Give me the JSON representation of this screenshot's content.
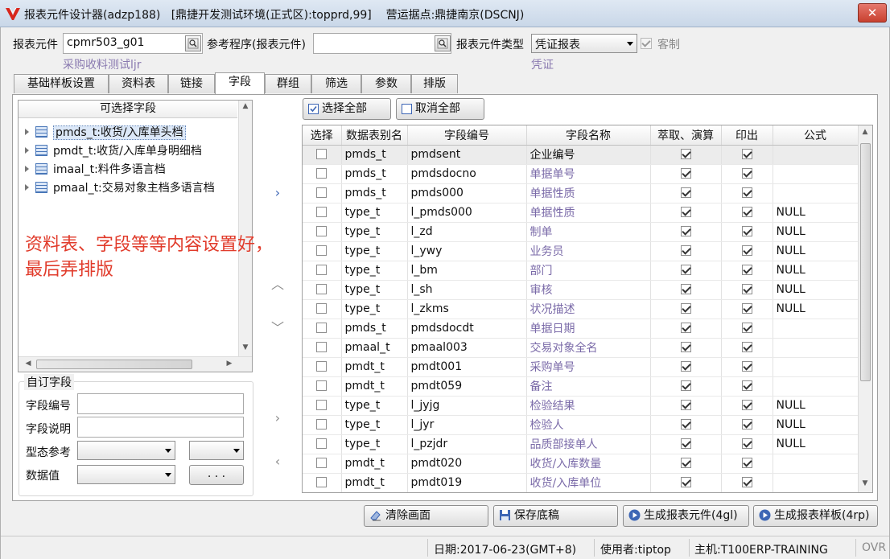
{
  "window": {
    "title": "报表元件设计器(adzp188)",
    "env": "[鼎捷开发测试环境(正式区):topprd,99]",
    "site": "营运据点:鼎捷南京(DSCNJ)",
    "close_label": "✕"
  },
  "header": {
    "report_element_label": "报表元件",
    "report_element_value": "cpmr503_g01",
    "report_element_desc": "采购收料测试ljr",
    "ref_program_label": "参考程序(报表元件)",
    "ref_program_value": "",
    "element_type_label": "报表元件类型",
    "element_type_value": "凭证报表",
    "element_type_desc": "凭证",
    "custom_label": "客制",
    "custom_checked": true
  },
  "tabs": [
    {
      "label": "基础样板设置"
    },
    {
      "label": "资料表"
    },
    {
      "label": "链接"
    },
    {
      "label": "字段"
    },
    {
      "label": "群组"
    },
    {
      "label": "筛选"
    },
    {
      "label": "参数"
    },
    {
      "label": "排版"
    }
  ],
  "active_tab": "字段",
  "tree": {
    "header": "可选择字段",
    "items": [
      {
        "label": "pmds_t:收货/入库单头档"
      },
      {
        "label": "pmdt_t:收货/入库单身明细档"
      },
      {
        "label": "imaal_t:料件多语言档"
      },
      {
        "label": "pmaal_t:交易对象主档多语言档"
      }
    ]
  },
  "annotation": {
    "line1": "资料表、字段等等内容设置好，",
    "line2": "最后弄排版"
  },
  "custom_field": {
    "title": "自订字段",
    "field_no_label": "字段编号",
    "field_desc_label": "字段说明",
    "type_ref_label": "型态参考",
    "data_value_label": "数据值",
    "more_button_label": ". . ."
  },
  "toolbar": {
    "select_all": "选择全部",
    "deselect_all": "取消全部"
  },
  "grid": {
    "columns": [
      "选择",
      "数据表别名",
      "字段编号",
      "字段名称",
      "萃取、演算",
      "印出",
      "公式"
    ],
    "rows": [
      {
        "alias": "pmds_t",
        "field": "pmdsent",
        "name": "企业编号",
        "formula": ""
      },
      {
        "alias": "pmds_t",
        "field": "pmdsdocno",
        "name": "单据单号",
        "formula": ""
      },
      {
        "alias": "pmds_t",
        "field": "pmds000",
        "name": "单据性质",
        "formula": ""
      },
      {
        "alias": "type_t",
        "field": "l_pmds000",
        "name": "单据性质",
        "formula": "NULL"
      },
      {
        "alias": "type_t",
        "field": "l_zd",
        "name": "制单",
        "formula": "NULL"
      },
      {
        "alias": "type_t",
        "field": "l_ywy",
        "name": "业务员",
        "formula": "NULL"
      },
      {
        "alias": "type_t",
        "field": "l_bm",
        "name": "部门",
        "formula": "NULL"
      },
      {
        "alias": "type_t",
        "field": "l_sh",
        "name": "审核",
        "formula": "NULL"
      },
      {
        "alias": "type_t",
        "field": "l_zkms",
        "name": "状况描述",
        "formula": "NULL"
      },
      {
        "alias": "pmds_t",
        "field": "pmdsdocdt",
        "name": "单据日期",
        "formula": ""
      },
      {
        "alias": "pmaal_t",
        "field": "pmaal003",
        "name": "交易对象全名",
        "formula": ""
      },
      {
        "alias": "pmdt_t",
        "field": "pmdt001",
        "name": "采购单号",
        "formula": ""
      },
      {
        "alias": "pmdt_t",
        "field": "pmdt059",
        "name": "备注",
        "formula": ""
      },
      {
        "alias": "type_t",
        "field": "l_jyjg",
        "name": "检验结果",
        "formula": "NULL"
      },
      {
        "alias": "type_t",
        "field": "l_jyr",
        "name": "检验人",
        "formula": "NULL"
      },
      {
        "alias": "type_t",
        "field": "l_pzjdr",
        "name": "品质部接单人",
        "formula": "NULL"
      },
      {
        "alias": "pmdt_t",
        "field": "pmdt020",
        "name": "收货/入库数量",
        "formula": ""
      },
      {
        "alias": "pmdt_t",
        "field": "pmdt019",
        "name": "收货/入库单位",
        "formula": ""
      }
    ]
  },
  "actions": {
    "clear": "清除画面",
    "save": "保存底稿",
    "gen_element": "生成报表元件(4gl)",
    "gen_template": "生成报表样板(4rp)"
  },
  "status": {
    "date": "日期:2017-06-23(GMT+8)",
    "user": "使用者:tiptop",
    "host": "主机:T100ERP-TRAINING",
    "mode": "OVR"
  },
  "colors": {
    "accent": "#3d66b5",
    "annotation": "#e13b2b",
    "hint": "#8a7ab0"
  }
}
